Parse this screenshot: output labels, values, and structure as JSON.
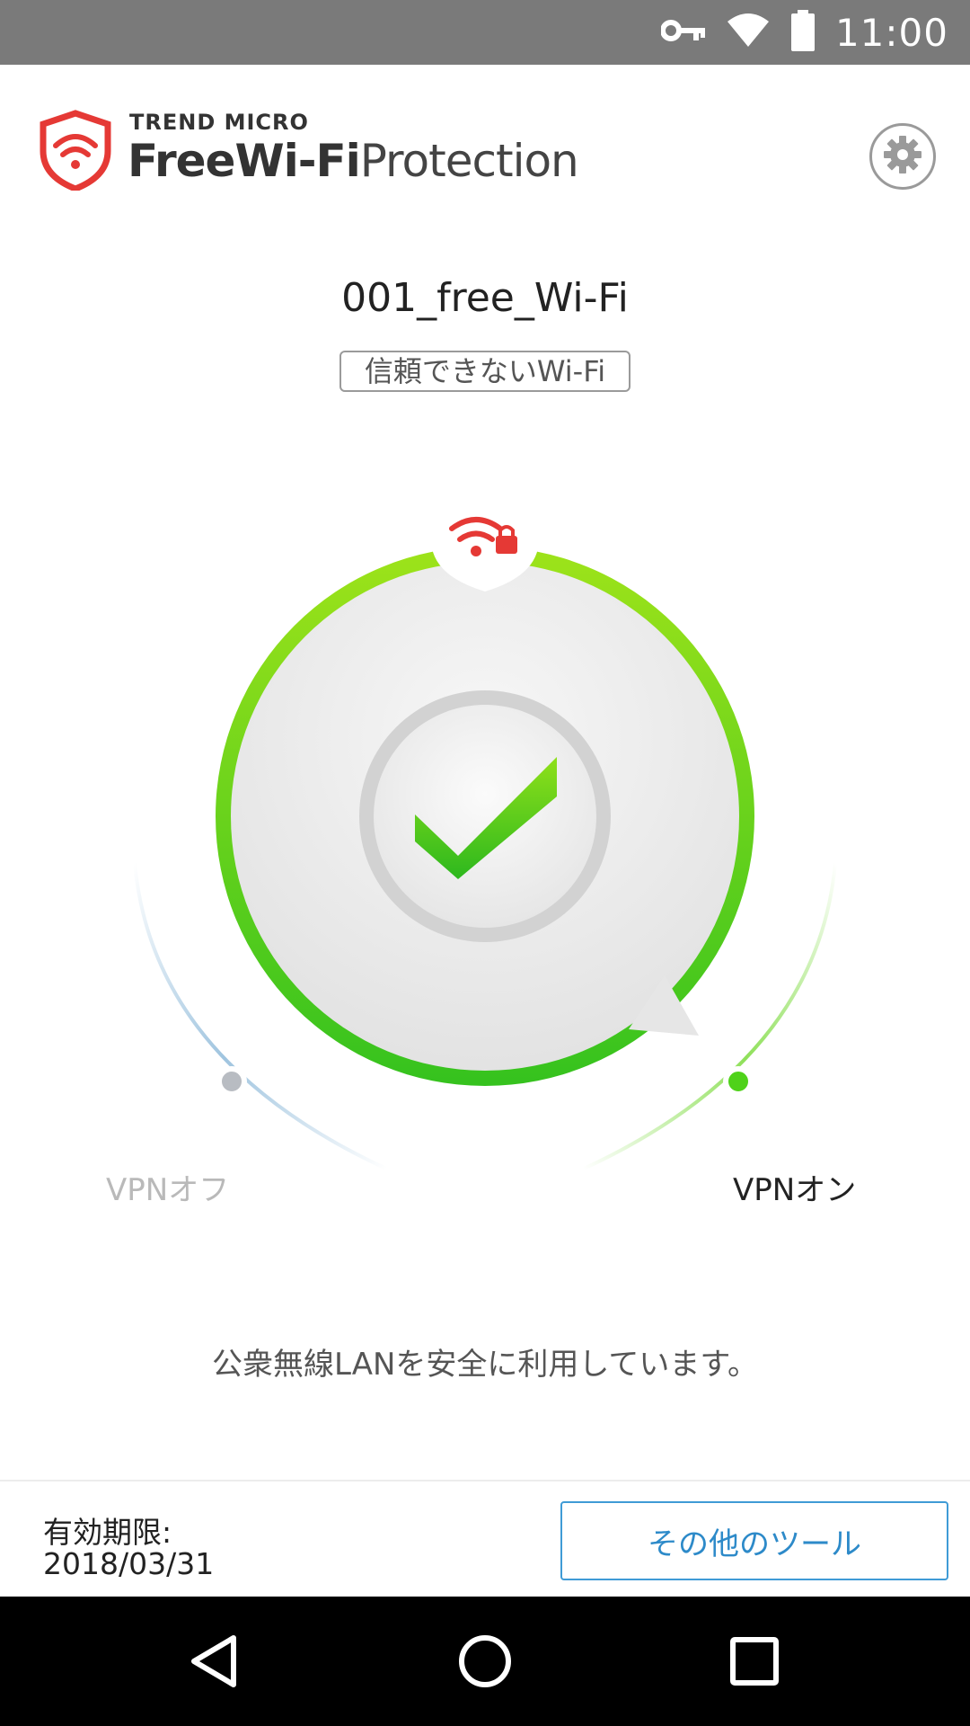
{
  "status_bar": {
    "time": "11:00",
    "icons": [
      "vpn-key-icon",
      "wifi-icon",
      "battery-icon"
    ]
  },
  "header": {
    "brand_top": "TREND MICRO",
    "brand_bold": "FreeWi-Fi",
    "brand_light": "Protection",
    "logo_icon": "shield-wifi-icon",
    "settings_icon": "gear-icon"
  },
  "network": {
    "ssid": "001_free_Wi-Fi",
    "trust_label": "信頼できないWi-Fi"
  },
  "vpn": {
    "off_label": "VPNオフ",
    "on_label": "VPNオン",
    "state": "on",
    "badge_icon": "wifi-lock-icon",
    "center_icon": "checkmark-icon"
  },
  "message": "公衆無線LANを安全に利用しています。",
  "footer": {
    "expiry_label": "有効期限:",
    "expiry_date": "2018/03/31",
    "tools_button": "その他のツール"
  },
  "nav": {
    "back_icon": "back-triangle-icon",
    "home_icon": "home-circle-icon",
    "recents_icon": "recents-square-icon"
  },
  "colors": {
    "accent_green": "#4fd21a",
    "brand_red": "#e53935",
    "button_blue": "#2d8ac9"
  }
}
